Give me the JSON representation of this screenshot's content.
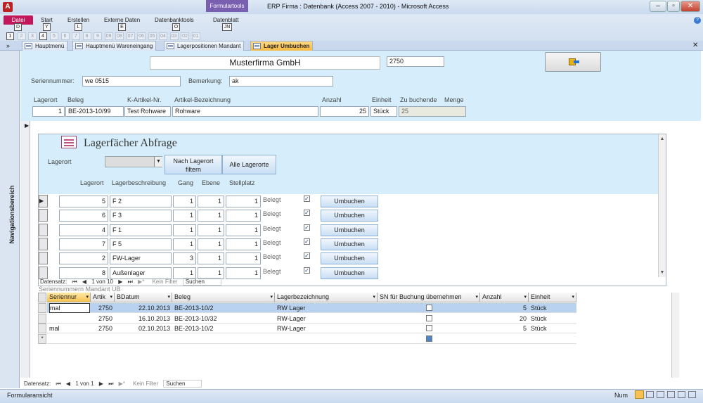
{
  "window": {
    "title": "ERP Firma : Datenbank (Access 2007 - 2010)  -  Microsoft Access",
    "context_group": "Formulartools",
    "app_icon": "A"
  },
  "ribbon": {
    "tabs": [
      "Datei",
      "Start",
      "Erstellen",
      "Externe Daten",
      "Datenbanktools",
      "Datenblatt"
    ],
    "keytips": [
      "D",
      "Y",
      "L",
      "E",
      "O",
      "JN"
    ],
    "qa_keytips": [
      "1",
      "2",
      "3",
      "4",
      "5",
      "6",
      "7",
      "8",
      "9",
      "09",
      "08",
      "07",
      "06",
      "05",
      "04",
      "03",
      "02",
      "01"
    ]
  },
  "doc_tabs": [
    "Hauptmenü",
    "Hauptmenü Wareneingang",
    "Lagerpositionen Mandant",
    "Lager Umbuchen"
  ],
  "nav_pane": {
    "label": "Navigationsbereich"
  },
  "header": {
    "company": "Musterfirma GmbH",
    "number": "2750",
    "serial_label": "Seriennummer:",
    "serial_value": "we 0515",
    "remark_label": "Bemerkung:",
    "remark_value": "ak",
    "labels": {
      "lagerort": "Lagerort",
      "beleg": "Beleg",
      "kartikel": "K-Artikel-Nr.",
      "bezeichnung": "Artikel-Bezeichnung",
      "anzahl": "Anzahl",
      "einheit": "Einheit",
      "zubuchen": "Zu buchende",
      "menge": "Menge"
    },
    "values": {
      "lagerort": "1",
      "beleg": "BE-2013-10/99",
      "kartikel": "Test Rohware",
      "bezeichnung": "Rohware",
      "anzahl": "25",
      "einheit": "Stück",
      "zubuchen": "25"
    }
  },
  "sub1": {
    "title": "Lagerfächer Abfrage",
    "filter_label": "Lagerort",
    "btn_filter": "Nach Lagerort filtern",
    "btn_all": "Alle Lagerorte",
    "columns": [
      "Lagerort",
      "Lagerbeschreibung",
      "Gang",
      "Ebene",
      "Stellplatz"
    ],
    "rows": [
      {
        "lagerort": "5",
        "beschreibung": "F 2",
        "gang": "1",
        "ebene": "1",
        "stellplatz": "1",
        "status": "Belegt",
        "checked": "✓",
        "action": "Umbuchen"
      },
      {
        "lagerort": "6",
        "beschreibung": "F 3",
        "gang": "1",
        "ebene": "1",
        "stellplatz": "1",
        "status": "Belegt",
        "checked": "✓",
        "action": "Umbuchen"
      },
      {
        "lagerort": "4",
        "beschreibung": "F 1",
        "gang": "1",
        "ebene": "1",
        "stellplatz": "1",
        "status": "Belegt",
        "checked": "✓",
        "action": "Umbuchen"
      },
      {
        "lagerort": "7",
        "beschreibung": "F 5",
        "gang": "1",
        "ebene": "1",
        "stellplatz": "1",
        "status": "Belegt",
        "checked": "✓",
        "action": "Umbuchen"
      },
      {
        "lagerort": "2",
        "beschreibung": "FW-Lager",
        "gang": "3",
        "ebene": "1",
        "stellplatz": "1",
        "status": "Belegt",
        "checked": "✓",
        "action": "Umbuchen"
      },
      {
        "lagerort": "8",
        "beschreibung": "Außenlager",
        "gang": "1",
        "ebene": "1",
        "stellplatz": "1",
        "status": "Belegt",
        "checked": "✓",
        "action": "Umbuchen"
      }
    ],
    "nav": {
      "label": "Datensatz:",
      "pos": "1 von 10",
      "filter": "Kein Filter",
      "search": "Suchen"
    }
  },
  "sub2": {
    "caption": "Seriennummern Mandant UB",
    "columns": [
      "Seriennur",
      "Artik",
      "BDatum",
      "Beleg",
      "Lagerbezeichnung",
      "SN für Buchung übernehmen",
      "Anzahl",
      "Einheit"
    ],
    "rows": [
      {
        "sn": "mal",
        "artikel": "2750",
        "datum": "22.10.2013",
        "beleg": "BE-2013-10/2",
        "lager": "RW Lager",
        "check": "",
        "anzahl": "5",
        "einheit": "Stück"
      },
      {
        "sn": "",
        "artikel": "2750",
        "datum": "16.10.2013",
        "beleg": "BE-2013-10/32",
        "lager": "RW-Lager",
        "check": "",
        "anzahl": "20",
        "einheit": "Stück"
      },
      {
        "sn": "mal",
        "artikel": "2750",
        "datum": "02.10.2013",
        "beleg": "BE-2013-10/2",
        "lager": "RW-Lager",
        "check": "",
        "anzahl": "5",
        "einheit": "Stück"
      }
    ],
    "new_row_marker": "*"
  },
  "main_nav": {
    "label": "Datensatz:",
    "pos": "1 von 1",
    "filter": "Kein Filter",
    "search": "Suchen"
  },
  "status": {
    "left": "Formularansicht",
    "num": "Num"
  }
}
